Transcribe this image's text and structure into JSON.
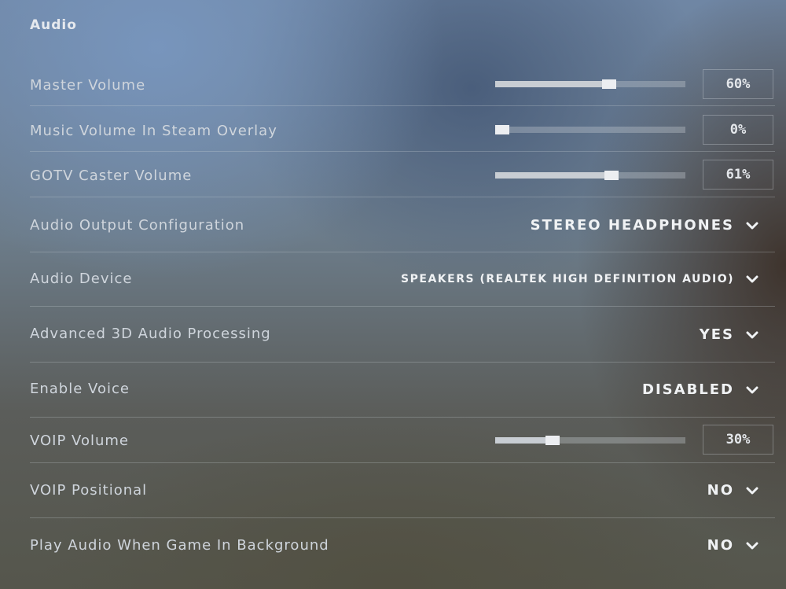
{
  "section": {
    "title": "Audio"
  },
  "rows": [
    {
      "label": "Master Volume",
      "type": "slider",
      "value": "60%",
      "level": 0.6
    },
    {
      "label": "Music Volume In Steam Overlay",
      "type": "slider",
      "value": "0%",
      "level": 0.0
    },
    {
      "label": "GOTV Caster Volume",
      "type": "slider",
      "value": "61%",
      "level": 0.61
    },
    {
      "label": "Audio Output Configuration",
      "type": "dropdown",
      "value": "STEREO HEADPHONES"
    },
    {
      "label": "Audio Device",
      "type": "dropdown",
      "value": "SPEAKERS (REALTEK HIGH DEFINITION AUDIO)"
    },
    {
      "label": "Advanced 3D Audio Processing",
      "type": "dropdown",
      "value": "YES"
    },
    {
      "label": "Enable Voice",
      "type": "dropdown",
      "value": "DISABLED"
    },
    {
      "label": "VOIP Volume",
      "type": "slider",
      "value": "30%",
      "level": 0.3
    },
    {
      "label": "VOIP Positional",
      "type": "dropdown",
      "value": "NO"
    },
    {
      "label": "Play Audio When Game In Background",
      "type": "dropdown",
      "value": "NO"
    }
  ],
  "icons": {
    "dropdown": "chevron-down-icon"
  },
  "colors": {
    "text": "#cfd5dc",
    "value": "#f0f2f4",
    "slider_track": "#c8cdd3"
  }
}
